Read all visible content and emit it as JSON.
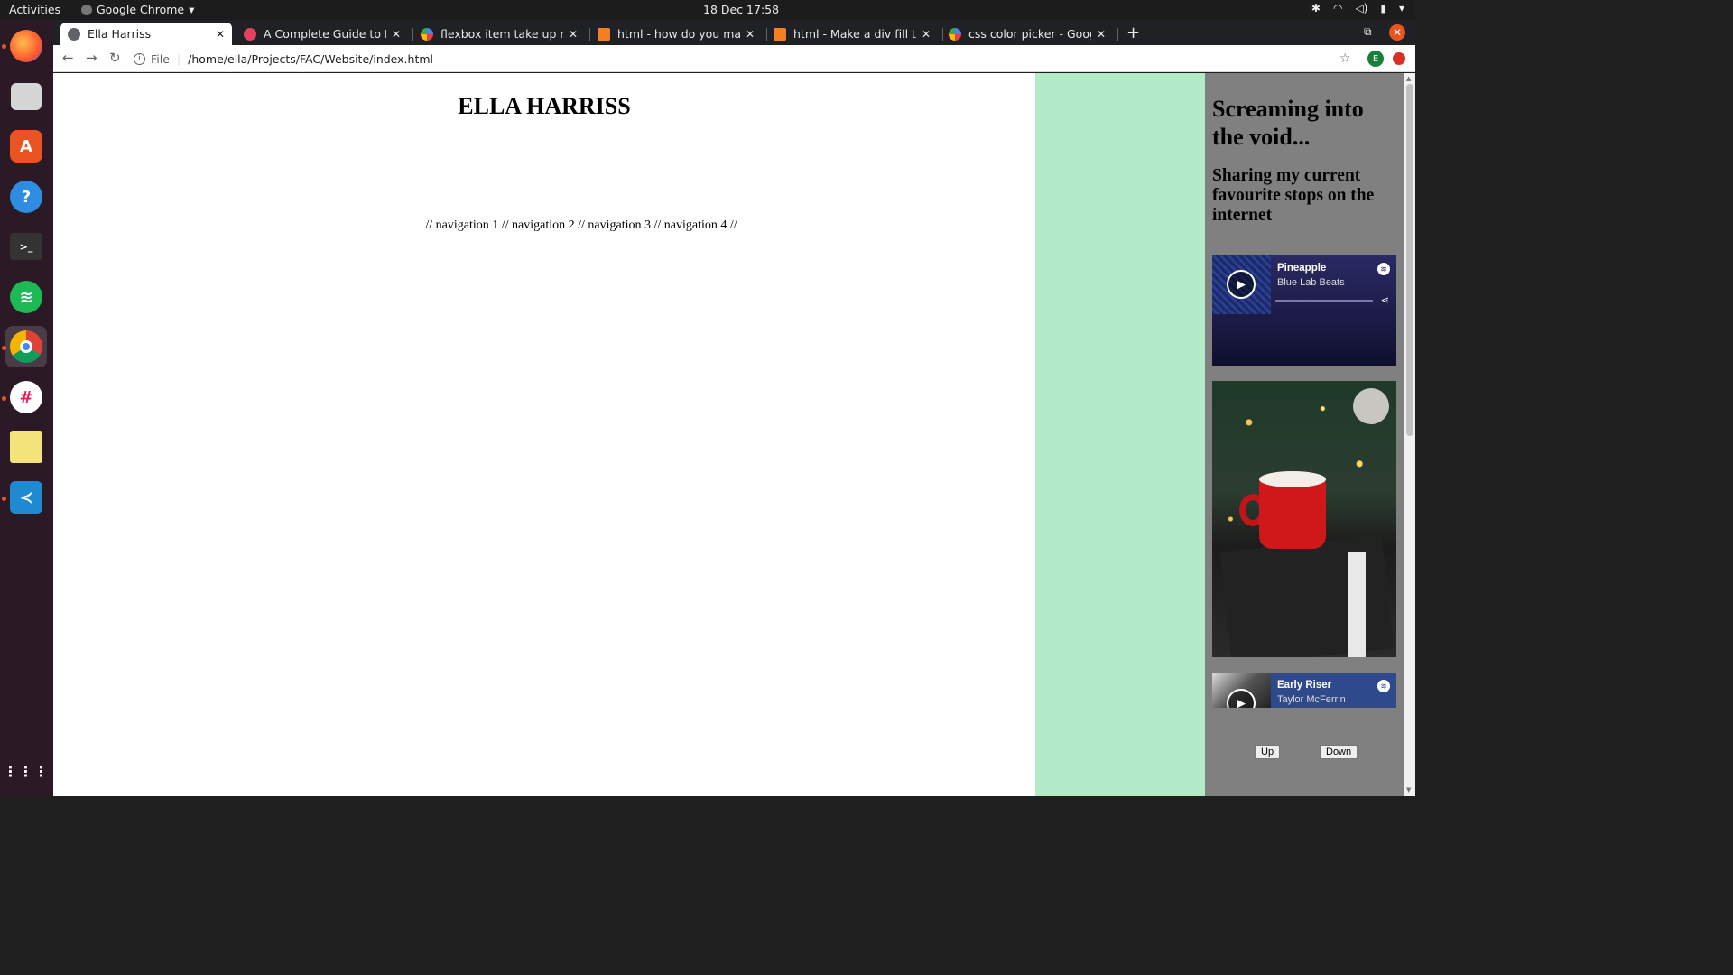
{
  "topbar": {
    "activities": "Activities",
    "app_name": "Google Chrome",
    "clock": "18 Dec  17:58"
  },
  "dock": {
    "items": [
      "firefox",
      "files",
      "software",
      "help",
      "terminal",
      "spotify",
      "chrome",
      "slack",
      "notes",
      "vscode",
      "show-apps"
    ]
  },
  "tabs": [
    {
      "title": "Ella Harriss",
      "active": true
    },
    {
      "title": "A Complete Guide to Flexbox",
      "active": false
    },
    {
      "title": "flexbox item take up remaining",
      "active": false
    },
    {
      "title": "html - how do you make a div",
      "active": false
    },
    {
      "title": "html - Make a div fill the height",
      "active": false
    },
    {
      "title": "css color picker - Google Search",
      "active": false
    }
  ],
  "toolbar": {
    "scheme": "File",
    "url": "/home/ella/Projects/FAC/Website/index.html"
  },
  "page": {
    "title": "ELLA HARRISS",
    "nav": "// navigation 1 // navigation 2 // navigation 3 // navigation 4 //",
    "sidebar": {
      "heading": "Screaming into the void...",
      "subheading": "Sharing my current favourite stops on the internet",
      "embeds": [
        {
          "track": "Pineapple",
          "artist": "Blue Lab Beats"
        },
        {
          "track": "Early Riser",
          "artist": "Taylor McFerrin"
        }
      ],
      "up_label": "Up",
      "down_label": "Down"
    }
  },
  "colors": {
    "green_column": "#b3eac8",
    "sidebar_bg": "#808080",
    "accent": "#e95420"
  }
}
